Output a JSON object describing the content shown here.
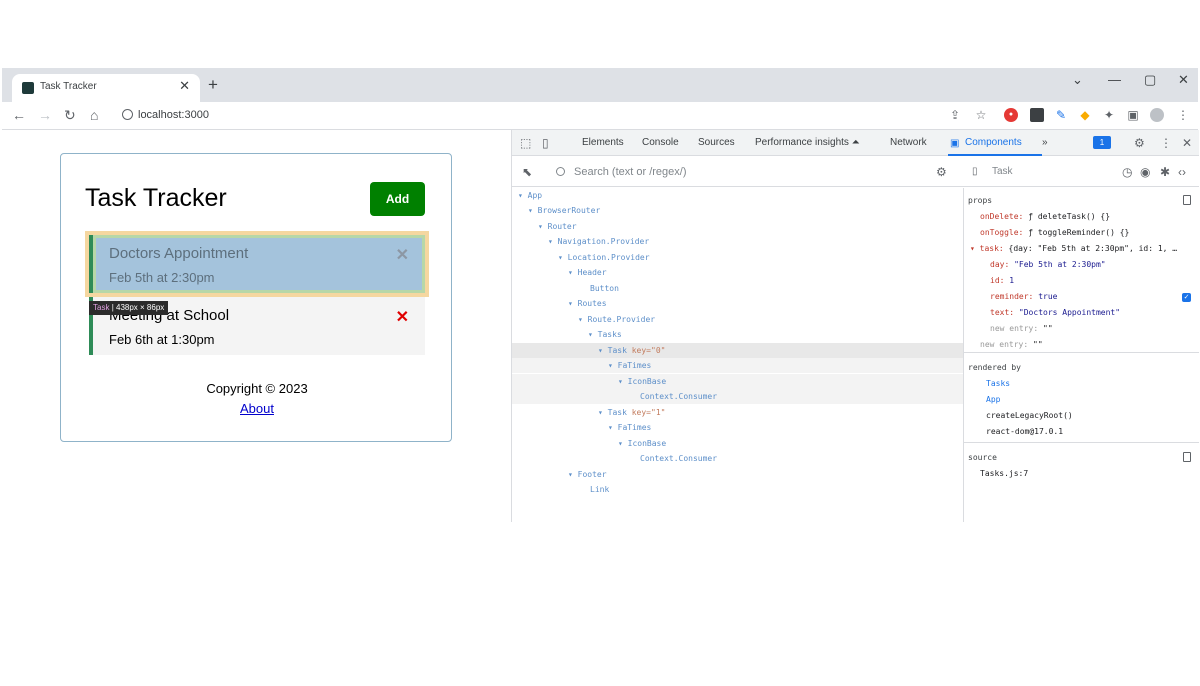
{
  "browser": {
    "tab_title": "Task Tracker",
    "new_tab": "+",
    "tab_close": "✕",
    "url": "localhost:3000",
    "controls": {
      "chevron": "⌄",
      "minimize": "—",
      "maximize": "▢",
      "close": "✕"
    }
  },
  "app": {
    "title": "Task Tracker",
    "add_label": "Add",
    "tasks": [
      {
        "text": "Doctors Appointment",
        "day": "Feb 5th at 2:30pm",
        "delete": "✕"
      },
      {
        "text": "Meeting at School",
        "day": "Feb 6th at 1:30pm",
        "delete": "✕"
      }
    ],
    "inspect_tooltip": {
      "name": "Task",
      "size": "438px × 86px"
    },
    "copyright": "Copyright © 2023",
    "about_link": "About"
  },
  "devtools": {
    "tabs": [
      "Elements",
      "Console",
      "Sources",
      "Performance insights ⏶",
      "Network",
      "Components",
      "»"
    ],
    "active_tab": "Components",
    "badge": "1",
    "search_placeholder": "Search (text or /regex/)",
    "tree": [
      {
        "label": "App",
        "attrs": ""
      },
      {
        "label": "BrowserRouter",
        "attrs": ""
      },
      {
        "label": "Router",
        "attrs": ""
      },
      {
        "label": "Navigation.Provider",
        "attrs": ""
      },
      {
        "label": "Location.Provider",
        "attrs": ""
      },
      {
        "label": "Header",
        "attrs": ""
      },
      {
        "label": "Button",
        "attrs": ""
      },
      {
        "label": "Routes",
        "attrs": ""
      },
      {
        "label": "Route.Provider",
        "attrs": ""
      },
      {
        "label": "Tasks",
        "attrs": ""
      },
      {
        "label": "Task",
        "attrs": "key=\"0\""
      },
      {
        "label": "FaTimes",
        "attrs": ""
      },
      {
        "label": "IconBase",
        "attrs": ""
      },
      {
        "label": "Context.Consumer",
        "attrs": ""
      },
      {
        "label": "Task",
        "attrs": "key=\"1\""
      },
      {
        "label": "FaTimes",
        "attrs": ""
      },
      {
        "label": "IconBase",
        "attrs": ""
      },
      {
        "label": "Context.Consumer",
        "attrs": ""
      },
      {
        "label": "Footer",
        "attrs": ""
      },
      {
        "label": "Link",
        "attrs": ""
      }
    ],
    "selected": {
      "component": "Task"
    },
    "props_section": {
      "title": "props",
      "items": [
        {
          "key": "onDelete:",
          "value": "ƒ deleteTask() {}"
        },
        {
          "key": "onToggle:",
          "value": "ƒ toggleReminder() {}"
        },
        {
          "key": "▾ task:",
          "value": "{day: \"Feb 5th at 2:30pm\", id: 1, …"
        },
        {
          "key": "day:",
          "value": "\"Feb 5th at 2:30pm\""
        },
        {
          "key": "id:",
          "value": "1"
        },
        {
          "key": "reminder:",
          "value": "true"
        },
        {
          "key": "text:",
          "value": "\"Doctors Appointment\""
        },
        {
          "key": "new entry:",
          "value": "\"\""
        },
        {
          "key": "new entry:",
          "value": "\"\""
        }
      ]
    },
    "rendered_by": {
      "title": "rendered by",
      "items": [
        "Tasks",
        "App",
        "createLegacyRoot()",
        "react-dom@17.0.1"
      ]
    },
    "source": {
      "title": "source",
      "file": "Tasks.js:7"
    }
  }
}
